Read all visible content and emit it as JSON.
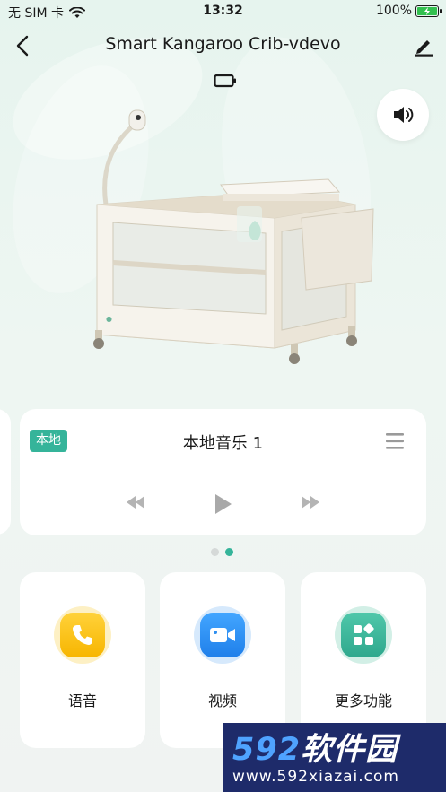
{
  "status_bar": {
    "carrier": "无 SIM 卡",
    "time": "13:32",
    "battery_percent": "100%"
  },
  "nav": {
    "title": "Smart Kangaroo Crib-vdevo"
  },
  "music": {
    "badge": "本地",
    "track_title": "本地音乐 1"
  },
  "pagination": {
    "pages": 2,
    "active_index": 1
  },
  "features": [
    {
      "label": "语音",
      "icon": "phone-icon",
      "color": "#f7b500"
    },
    {
      "label": "视频",
      "icon": "video-camera-icon",
      "color": "#2d8ef0"
    },
    {
      "label": "更多功能",
      "icon": "grid-more-icon",
      "color": "#35b49a"
    }
  ],
  "watermark": {
    "brand_num": "592",
    "brand_text": "软件园",
    "url": "www.592xiazai.com"
  },
  "colors": {
    "accent": "#35b49a",
    "background": "#e6f4ee"
  }
}
